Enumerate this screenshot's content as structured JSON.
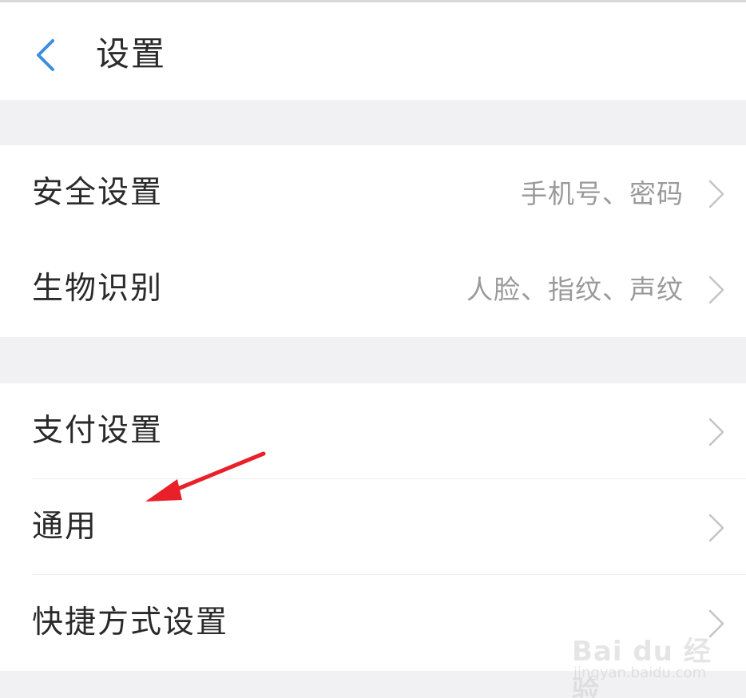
{
  "header": {
    "title": "设置"
  },
  "groups": [
    {
      "items": [
        {
          "label": "安全设置",
          "value": "手机号、密码"
        },
        {
          "label": "生物识别",
          "value": "人脸、指纹、声纹"
        }
      ]
    },
    {
      "items": [
        {
          "label": "支付设置",
          "value": ""
        },
        {
          "label": "通用",
          "value": ""
        },
        {
          "label": "快捷方式设置",
          "value": ""
        }
      ]
    }
  ],
  "watermark": {
    "brand": "Bai du 经验",
    "url": "jingyan.baidu.com"
  },
  "colors": {
    "accent": "#3b8fe0",
    "annotation_arrow": "#e8202a",
    "background": "#f1f1f4"
  },
  "icons": {
    "back": "chevron-left-icon",
    "row_arrow": "chevron-right-icon"
  }
}
